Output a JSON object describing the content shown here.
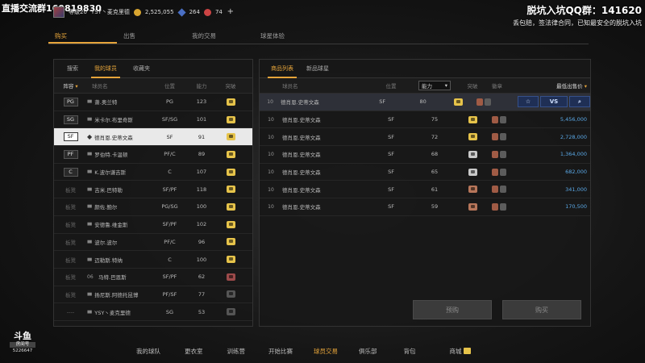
{
  "overlay": {
    "stream_group": "直播交流群160819830",
    "qq_group": "脱坑入坑QQ群：141620",
    "slogan": "丢包赔，签法律合同，已知最安全的脱坑入坑"
  },
  "player": {
    "level": "等级20",
    "name": "YSY丶麦克里德",
    "coins": "2,525,055",
    "gems": "264",
    "tickets": "74",
    "plus": "+"
  },
  "main_tabs": [
    "购买",
    "出售",
    "我的交易",
    "球星体验"
  ],
  "left": {
    "subtabs": [
      "搜索",
      "我的球员",
      "收藏夹"
    ],
    "headers": {
      "lineup": "阵容",
      "name": "球员名",
      "position": "位置",
      "ability": "能力",
      "breakthrough": "突破"
    },
    "rows": [
      {
        "slot": "PG",
        "name": "萧.奥兰特",
        "position": "PG",
        "ability": "123",
        "badge": "gold"
      },
      {
        "slot": "SG",
        "name": "米卡尔.布里奇斯",
        "position": "SF/SG",
        "ability": "101",
        "badge": "gold"
      },
      {
        "slot": "SF",
        "name": "德肖恩.史蒂文森",
        "position": "SF",
        "ability": "91",
        "badge": "gold"
      },
      {
        "slot": "PF",
        "name": "罗伯特.卡温顿",
        "position": "PF/C",
        "ability": "89",
        "badge": "gold"
      },
      {
        "slot": "C",
        "name": "K.波尔谦吉斯",
        "position": "C",
        "ability": "107",
        "badge": "gold"
      },
      {
        "slot": "板凳",
        "name": "吉米.巴特勒",
        "position": "SF/PF",
        "ability": "118",
        "badge": "gold"
      },
      {
        "slot": "板凳",
        "name": "颜佐.鲍尔",
        "position": "PG/SG",
        "ability": "100",
        "badge": "gold"
      },
      {
        "slot": "板凳",
        "name": "安德鲁.维金斯",
        "position": "SF/PF",
        "ability": "102",
        "badge": "gold"
      },
      {
        "slot": "板凳",
        "name": "波尔.波尔",
        "position": "PF/C",
        "ability": "96",
        "badge": "gold"
      },
      {
        "slot": "板凳",
        "name": "迈勒斯.特纳",
        "position": "C",
        "ability": "100",
        "badge": "gold"
      },
      {
        "slot": "板凳",
        "level": "06",
        "name": "马特.巴恩斯",
        "position": "SF/PF",
        "ability": "62",
        "badge": "red"
      },
      {
        "slot": "板凳",
        "name": "扬尼斯.阿德托昆博",
        "position": "PF/SF",
        "ability": "77",
        "badge": "dark"
      },
      {
        "slot": "----",
        "name": "YSY丶麦克里德",
        "position": "SG",
        "ability": "53",
        "badge": "dark"
      }
    ]
  },
  "right": {
    "subtabs": [
      "商品列表",
      "新品球星"
    ],
    "headers": {
      "name": "球员名",
      "position": "位置",
      "ability": "能力",
      "breakthrough": "突破",
      "gem": "徽章",
      "price": "最低出售价"
    },
    "actions": {
      "vs": "VS"
    },
    "rows": [
      {
        "level": "10",
        "name": "德肖恩.史蒂文森",
        "position": "SF",
        "ability": "80",
        "badge": "gold",
        "price": ""
      },
      {
        "level": "10",
        "name": "德肖恩.史蒂文森",
        "position": "SF",
        "ability": "75",
        "badge": "gold",
        "price": "5,456,000"
      },
      {
        "level": "10",
        "name": "德肖恩.史蒂文森",
        "position": "SF",
        "ability": "72",
        "badge": "gold",
        "price": "2,728,000"
      },
      {
        "level": "10",
        "name": "德肖恩.史蒂文森",
        "position": "SF",
        "ability": "68",
        "badge": "silver",
        "price": "1,364,000"
      },
      {
        "level": "10",
        "name": "德肖恩.史蒂文森",
        "position": "SF",
        "ability": "65",
        "badge": "silver",
        "price": "682,000"
      },
      {
        "level": "10",
        "name": "德肖恩.史蒂文森",
        "position": "SF",
        "ability": "61",
        "badge": "bronze",
        "price": "341,000"
      },
      {
        "level": "10",
        "name": "德肖恩.史蒂文森",
        "position": "SF",
        "ability": "59",
        "badge": "bronze",
        "price": "170,500"
      }
    ],
    "buttons": {
      "preorder": "预购",
      "buy": "购买"
    }
  },
  "bottom_nav": [
    "我的球队",
    "更衣室",
    "训练营",
    "开始比赛",
    "球员交易",
    "俱乐部",
    "背包",
    "商城"
  ],
  "logo": {
    "main": "斗鱼",
    "sub": "房间号",
    "room_id": "5226647"
  },
  "colors": {
    "accent": "#e6a43a",
    "price_blue": "#5aa8e6",
    "action_blue": "#1f2f55"
  }
}
